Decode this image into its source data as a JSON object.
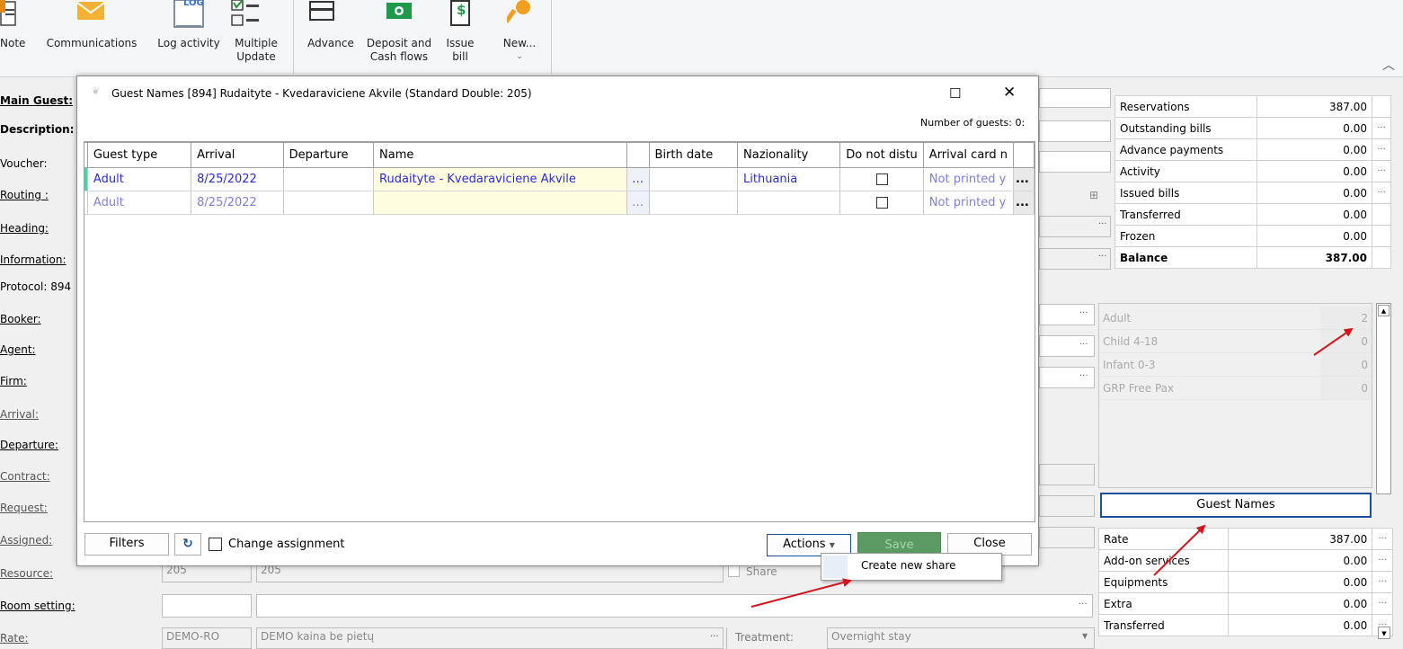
{
  "toolbar": {
    "note": "Note",
    "communications": "Communications",
    "log_activity": "Log activity",
    "log_icon_text": "LOG",
    "multiple_update_1": "Multiple",
    "multiple_update_2": "Update",
    "advance": "Advance",
    "deposit_1": "Deposit and",
    "deposit_2": "Cash flows",
    "issue_1": "Issue",
    "issue_2": "bill",
    "new": "New...",
    "dollar_sign": "$"
  },
  "form": {
    "main_guest": "Main Guest:",
    "description": "Description:",
    "voucher": "Voucher:",
    "routing": "Routing :",
    "heading": "Heading:",
    "information": "Information:",
    "protocol": "Protocol: 894",
    "booker": "Booker:",
    "agent": "Agent:",
    "firm": "Firm:",
    "arrival": "Arrival:",
    "departure": "Departure:",
    "contract": "Contract:",
    "request": "Request:",
    "assigned": "Assigned:",
    "resource": "Resource:",
    "room_setting": "Room setting:",
    "rate": "Rate:",
    "resource_val1": "205",
    "resource_val2": "205",
    "share": "Share",
    "rate_code": "DEMO-RO",
    "rate_name": "DEMO kaina be pietų",
    "treatment_label": "Treatment:",
    "treatment_val": "Overnight stay"
  },
  "summary": {
    "rows": [
      {
        "label": "Reservations",
        "value": "387.00",
        "dots": ""
      },
      {
        "label": "Outstanding bills",
        "value": "0.00",
        "dots": "···"
      },
      {
        "label": "Advance payments",
        "value": "0.00",
        "dots": "···"
      },
      {
        "label": "Activity",
        "value": "0.00",
        "dots": "···"
      },
      {
        "label": "Issued bills",
        "value": "0.00",
        "dots": "···"
      },
      {
        "label": "Transferred",
        "value": "0.00",
        "dots": ""
      },
      {
        "label": "Frozen",
        "value": "0.00",
        "dots": ""
      },
      {
        "label": "Balance",
        "value": "387.00",
        "dots": ""
      }
    ]
  },
  "pax": {
    "rows": [
      {
        "label": "Adult",
        "value": "2"
      },
      {
        "label": "Child 4-18",
        "value": "0"
      },
      {
        "label": "Infant 0-3",
        "value": "0"
      },
      {
        "label": "GRP Free Pax",
        "value": "0"
      }
    ]
  },
  "guest_names_button": "Guest Names",
  "rates": {
    "rows": [
      {
        "label": "Rate",
        "value": "387.00"
      },
      {
        "label": "Add-on services",
        "value": "0.00"
      },
      {
        "label": "Equipments",
        "value": "0.00"
      },
      {
        "label": "Extra",
        "value": "0.00"
      },
      {
        "label": "Transferred",
        "value": "0.00"
      }
    ]
  },
  "dialog": {
    "title": "Guest Names [894] Rudaityte - Kvedaraviciene Akvile (Standard Double: 205)",
    "number_of_guests": "Number of guests: 0:",
    "columns": [
      "Guest type",
      "Arrival",
      "Departure",
      "Name",
      "",
      "Birth date",
      "Nazionality",
      "Do not distu",
      "Arrival card n"
    ],
    "rows": [
      {
        "type": "Adult",
        "arrival": "8/25/2022",
        "departure": "",
        "name": "Rudaityte - Kvedaraviciene Akvile",
        "birth": "",
        "nationality": "Lithuania",
        "card": "Not printed y"
      },
      {
        "type": "Adult",
        "arrival": "8/25/2022",
        "departure": "",
        "name": "",
        "birth": "",
        "nationality": "",
        "card": "Not printed y"
      }
    ],
    "filters": "Filters",
    "change_assignment": "Change assignment",
    "actions": "Actions",
    "save": "Save",
    "close": "Close",
    "menu_create_share": "Create new share"
  },
  "colors": {
    "link_blue": "#2b2bd6",
    "save_green": "#5b9a62",
    "arrow_red": "#d4141a",
    "accent_blue": "#1e4f9c"
  }
}
